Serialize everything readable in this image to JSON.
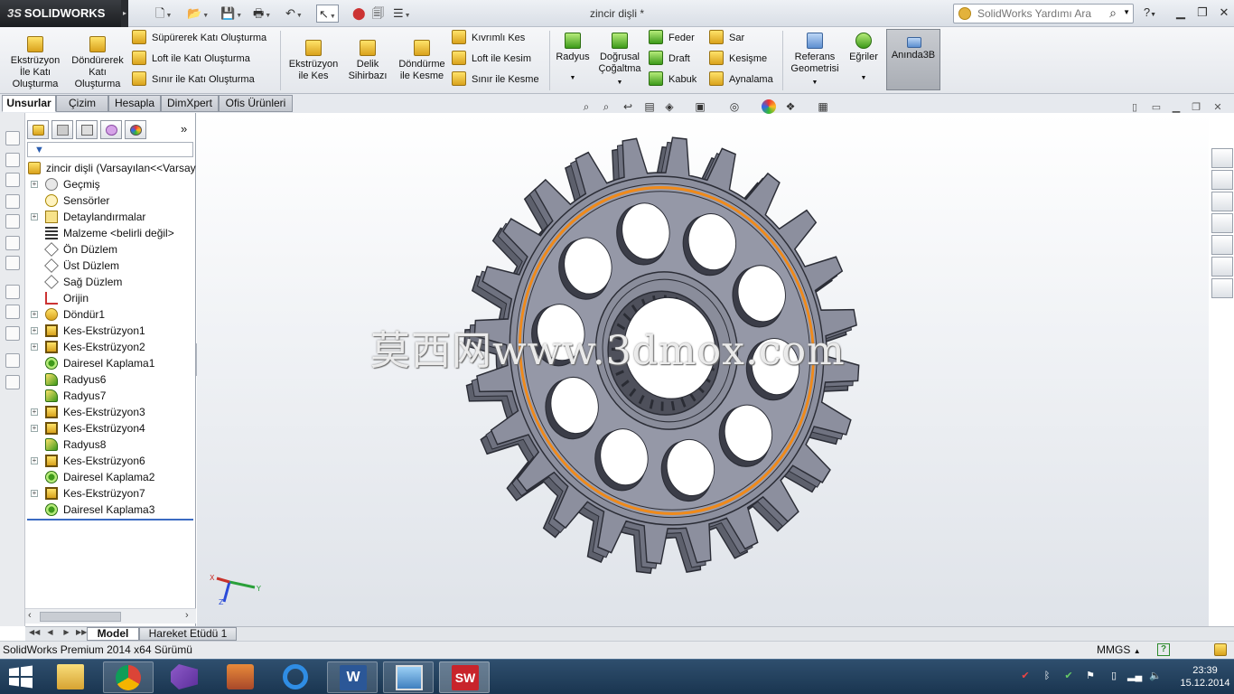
{
  "titlebar": {
    "app_logo": "SOLIDWORKS",
    "document_title": "zincir dişli *",
    "search_placeholder": "SolidWorks Yardımı Ara",
    "help_label": "?"
  },
  "ribbon": {
    "big_buttons": [
      {
        "id": "extrude-boss",
        "label": "Ekstrüzyon\nİle Katı\nOluşturma"
      },
      {
        "id": "revolve-boss",
        "label": "Döndürerek\nKatı\nOluşturma"
      },
      {
        "id": "extrude-cut",
        "label": "Ekstrüzyon\nile Kes"
      },
      {
        "id": "hole-wizard",
        "label": "Delik\nSihirbazı"
      },
      {
        "id": "revolve-cut",
        "label": "Döndürme\nile Kesme"
      },
      {
        "id": "fillet",
        "label": "Radyus"
      },
      {
        "id": "linear-pattern",
        "label": "Doğrusal\nÇoğaltma"
      },
      {
        "id": "ref-geometry",
        "label": "Referans\nGeometrisi"
      },
      {
        "id": "curves",
        "label": "Eğriler"
      },
      {
        "id": "instant3d",
        "label": "Anında3B"
      }
    ],
    "small_buttons": [
      {
        "id": "sweep-boss",
        "label": "Süpürerek Katı Oluşturma"
      },
      {
        "id": "loft-boss",
        "label": "Loft ile Katı Oluşturma"
      },
      {
        "id": "boundary-boss",
        "label": "Sınır ile Katı Oluşturma"
      },
      {
        "id": "swept-cut",
        "label": "Kıvrımlı Kes"
      },
      {
        "id": "loft-cut",
        "label": "Loft ile Kesim"
      },
      {
        "id": "boundary-cut",
        "label": "Sınır ile Kesme"
      },
      {
        "id": "rib",
        "label": "Feder"
      },
      {
        "id": "draft",
        "label": "Draft"
      },
      {
        "id": "shell",
        "label": "Kabuk"
      },
      {
        "id": "wrap",
        "label": "Sar"
      },
      {
        "id": "intersect",
        "label": "Kesişme"
      },
      {
        "id": "mirror",
        "label": "Aynalama"
      }
    ]
  },
  "command_tabs": [
    "Unsurlar",
    "Çizim",
    "Hesapla",
    "DimXpert",
    "Ofis Ürünleri"
  ],
  "feature_tree": {
    "root": "zincir dişli  (Varsayılan<<Varsayılan>",
    "items": [
      {
        "label": "Geçmiş",
        "expand": "+",
        "icon": "history-icon"
      },
      {
        "label": "Sensörler",
        "expand": "",
        "icon": "sensor-icon"
      },
      {
        "label": "Detaylandırmalar",
        "expand": "+",
        "icon": "annotations-icon"
      },
      {
        "label": "Malzeme <belirli değil>",
        "expand": "",
        "icon": "material-icon"
      },
      {
        "label": "Ön Düzlem",
        "expand": "",
        "icon": "plane-icon"
      },
      {
        "label": "Üst Düzlem",
        "expand": "",
        "icon": "plane-icon"
      },
      {
        "label": "Sağ Düzlem",
        "expand": "",
        "icon": "plane-icon"
      },
      {
        "label": "Orijin",
        "expand": "",
        "icon": "origin-icon"
      },
      {
        "label": "Döndür1",
        "expand": "+",
        "icon": "revolve-feature-icon"
      },
      {
        "label": "Kes-Ekstrüzyon1",
        "expand": "+",
        "icon": "cut-extrude-icon"
      },
      {
        "label": "Kes-Ekstrüzyon2",
        "expand": "+",
        "icon": "cut-extrude-icon"
      },
      {
        "label": "Dairesel Kaplama1",
        "expand": "",
        "icon": "circular-pattern-icon"
      },
      {
        "label": "Radyus6",
        "expand": "",
        "icon": "fillet-feature-icon"
      },
      {
        "label": "Radyus7",
        "expand": "",
        "icon": "fillet-feature-icon"
      },
      {
        "label": "Kes-Ekstrüzyon3",
        "expand": "+",
        "icon": "cut-extrude-icon"
      },
      {
        "label": "Kes-Ekstrüzyon4",
        "expand": "+",
        "icon": "cut-extrude-icon"
      },
      {
        "label": "Radyus8",
        "expand": "",
        "icon": "fillet-feature-icon"
      },
      {
        "label": "Kes-Ekstrüzyon6",
        "expand": "+",
        "icon": "cut-extrude-icon"
      },
      {
        "label": "Dairesel Kaplama2",
        "expand": "",
        "icon": "circular-pattern-icon"
      },
      {
        "label": "Kes-Ekstrüzyon7",
        "expand": "+",
        "icon": "cut-extrude-icon"
      },
      {
        "label": "Dairesel Kaplama3",
        "expand": "",
        "icon": "circular-pattern-icon"
      }
    ]
  },
  "viewport": {
    "watermark": "莫西网www.3dmox.com",
    "gear_teeth": 24,
    "gear_holes": 10,
    "colors": {
      "gear": "#8c8f9e",
      "edge": "#2b2d36",
      "highlight": "#f08a1a"
    }
  },
  "bottom_tabs": [
    "Model",
    "Hareket Etüdü 1"
  ],
  "status": {
    "version": "SolidWorks Premium 2014 x64 Sürümü",
    "units": "MMGS",
    "units_arrow": "▲"
  },
  "taskbar": {
    "apps": [
      "file-explorer",
      "chrome",
      "visual-studio",
      "paint-app",
      "internet-explorer",
      "word",
      "photo-viewer",
      "solidworks"
    ],
    "time": "23:39",
    "date": "15.12.2014"
  }
}
